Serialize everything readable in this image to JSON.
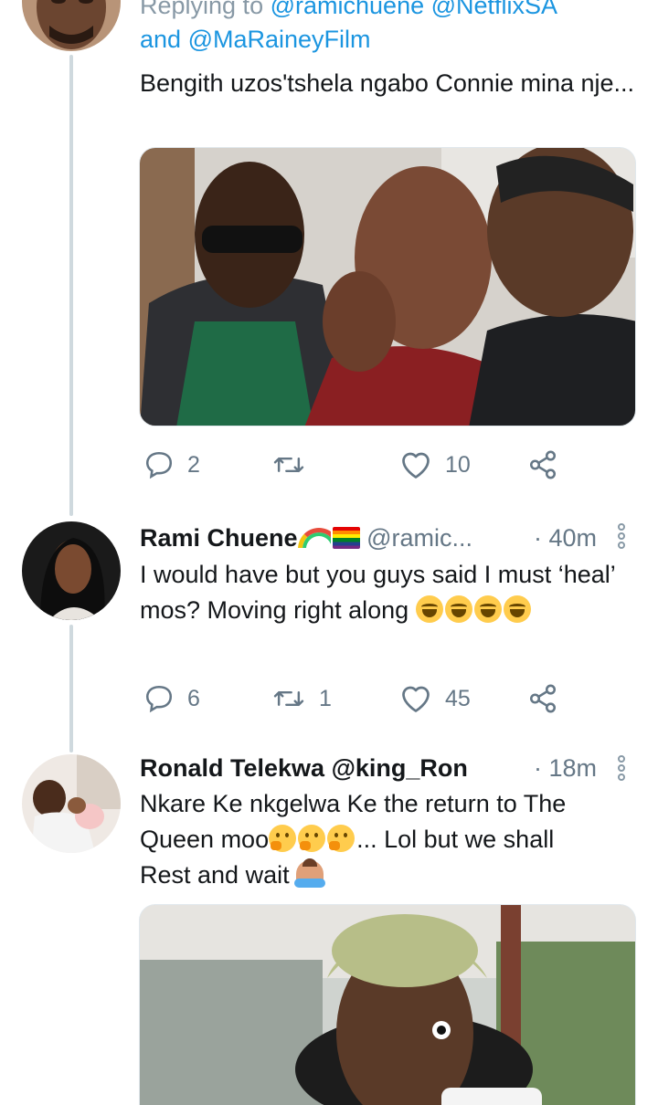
{
  "colors": {
    "link": "#1b95e0",
    "muted": "#657786",
    "thread_line": "#cfd9de"
  },
  "tweet1": {
    "reply_prefix": "Replying to",
    "mention1": "@ramichuene",
    "mention2": "@NetflixSA",
    "and": "and",
    "mention3": "@MaRaineyFilm",
    "text": "Bengith uzos'tshela ngabo Connie mina nje...",
    "actions": {
      "replies": "2",
      "retweets": "",
      "likes": "10"
    }
  },
  "tweet2": {
    "name": "Rami Chuene",
    "handle": "@ramic...",
    "time": "· 40m",
    "text": "I would have but you guys said I must ‘heal’ mos? Moving right along",
    "actions": {
      "replies": "6",
      "retweets": "1",
      "likes": "45"
    }
  },
  "tweet3": {
    "name": "Ronald Telekwa",
    "handle": "@king_Ron",
    "time": "· 18m",
    "text_line1": "Nkare Ke nkgelwa Ke the return to The",
    "text_line2_a": "Queen moo",
    "text_line2_b": "... Lol but we shall",
    "text_line3": "Rest and wait"
  },
  "icons": {
    "reply": "reply-icon",
    "retweet": "retweet-icon",
    "like": "heart-icon",
    "share": "share-icon",
    "more": "more-vertical-icon"
  }
}
